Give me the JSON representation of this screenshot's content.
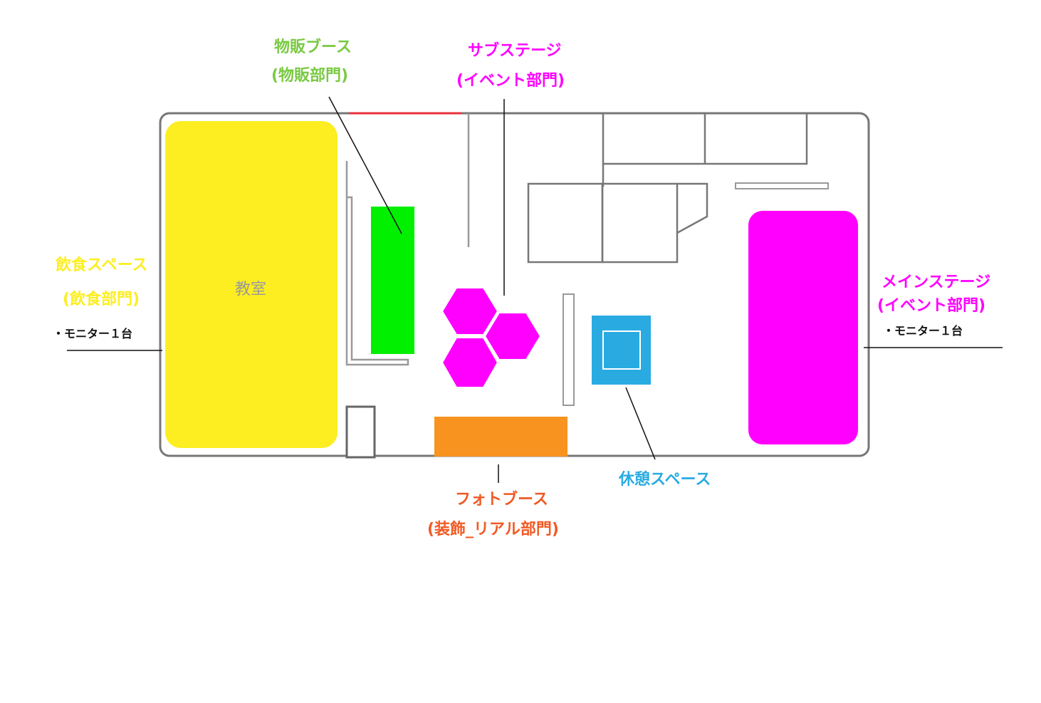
{
  "colors": {
    "dining": "#FCEE21",
    "merch": "#00F000",
    "merch_label": "#7AC943",
    "event": "#FF00FF",
    "photo": "#F7931E",
    "photo_label": "#F15A24",
    "rest": "#29ABE2",
    "wall": "#777777",
    "entrance": "#E8303A",
    "room_label": "#9a9a9a",
    "note": "#111111"
  },
  "classroom": {
    "label": "教室"
  },
  "zones": {
    "dining": {
      "title": "飲食スペース",
      "dept": "(飲食部門)",
      "note": "・モニター１台"
    },
    "merch": {
      "title": "物販ブース",
      "dept": "(物販部門)"
    },
    "sub_stage": {
      "title": "サブステージ",
      "dept": "(イベント部門)"
    },
    "main_stage": {
      "title": "メインステージ",
      "dept": "(イベント部門)",
      "note": "・モニター１台"
    },
    "photo_booth": {
      "title": "フォトブース",
      "dept": "(装飾_リアル部門)"
    },
    "rest_area": {
      "title": "休憩スペース"
    }
  }
}
